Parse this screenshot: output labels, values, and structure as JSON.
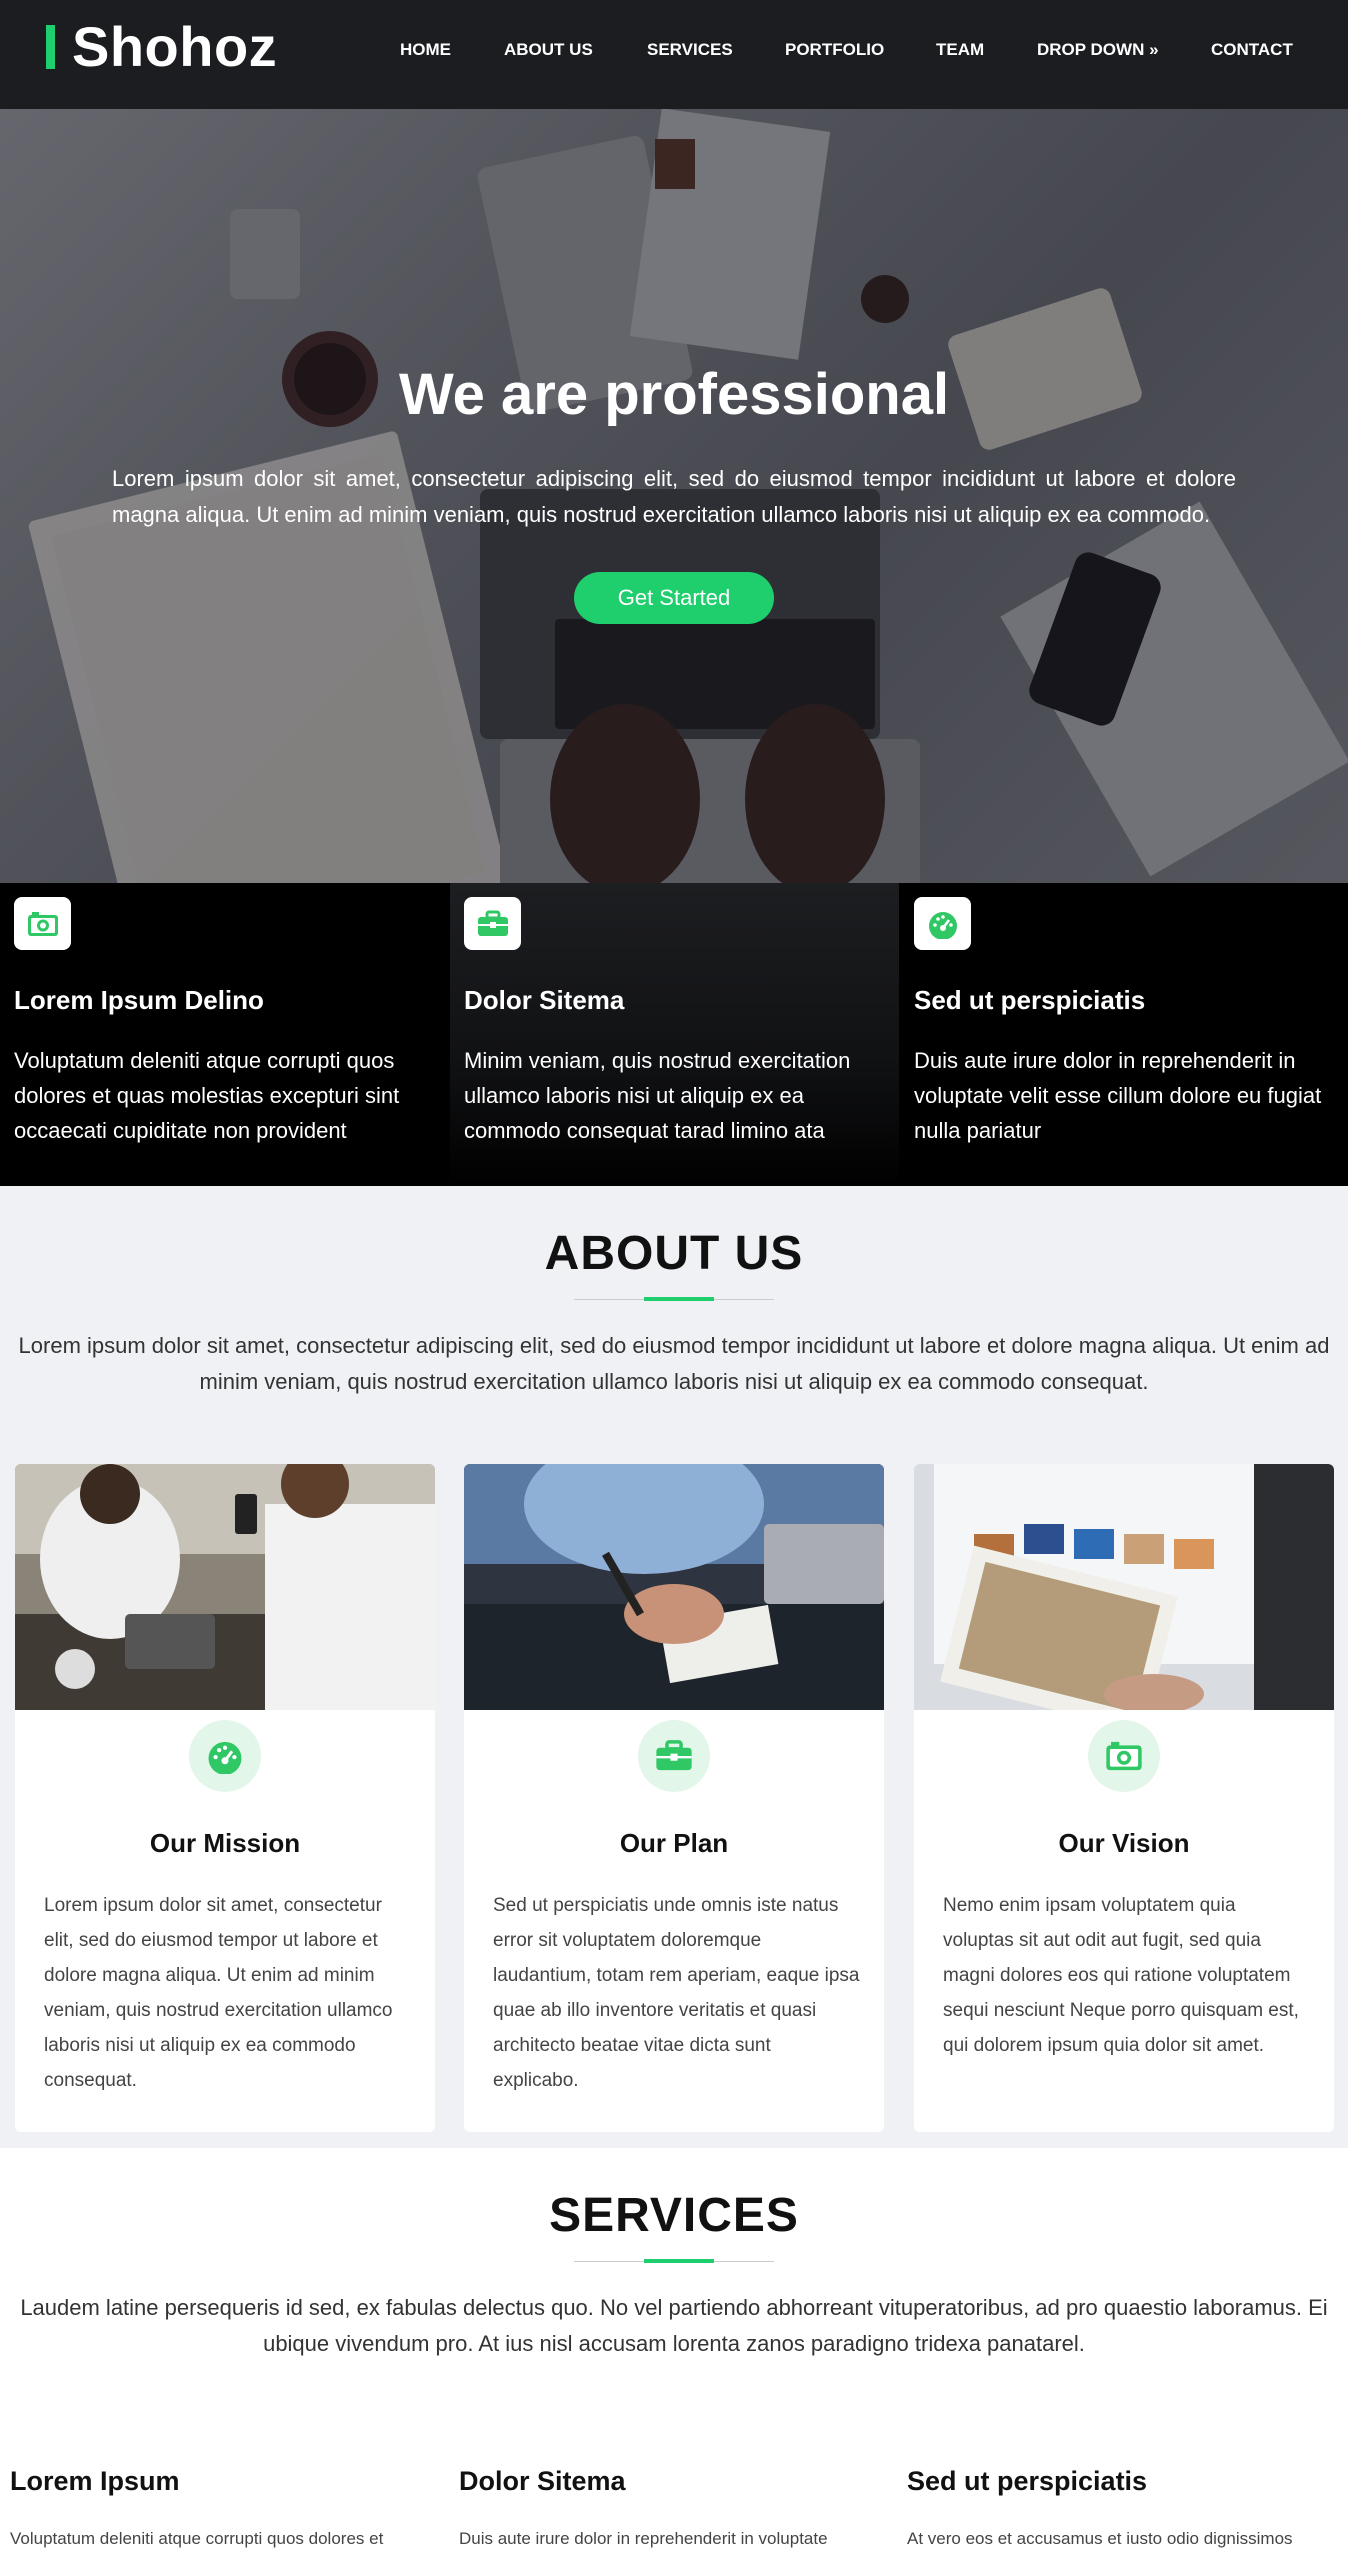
{
  "header": {
    "logo": "Shohoz",
    "nav": [
      "HOME",
      "ABOUT US",
      "SERVICES",
      "PORTFOLIO",
      "TEAM",
      "DROP DOWN »",
      "CONTACT"
    ]
  },
  "hero": {
    "title": "We are professional",
    "text": "Lorem ipsum dolor sit amet, consectetur adipiscing elit, sed do eiusmod tempor incididunt ut labore et dolore magna aliqua. Ut enim ad minim veniam, quis nostrud exercitation ullamco laboris nisi ut aliquip ex ea commodo.",
    "button": "Get Started"
  },
  "features": [
    {
      "icon": "camera-icon",
      "title": "Lorem Ipsum Delino",
      "text": "Voluptatum deleniti atque corrupti quos dolores et quas molestias excepturi sint occaecati cupiditate non provident"
    },
    {
      "icon": "briefcase-icon",
      "title": "Dolor Sitema",
      "text": "Minim veniam, quis nostrud exercitation ullamco laboris nisi ut aliquip ex ea commodo consequat tarad limino ata"
    },
    {
      "icon": "speedometer-icon",
      "title": "Sed ut perspiciatis",
      "text": "Duis aute irure dolor in reprehenderit in voluptate velit esse cillum dolore eu fugiat nulla pariatur"
    }
  ],
  "about": {
    "title": "ABOUT US",
    "lead": "Lorem ipsum dolor sit amet, consectetur adipiscing elit, sed do eiusmod tempor incididunt ut labore et dolore magna aliqua. Ut enim ad minim veniam, quis nostrud exercitation ullamco laboris nisi ut aliquip ex ea commodo consequat.",
    "cards": [
      {
        "icon": "speedometer-icon",
        "title": "Our Mission",
        "text": "Lorem ipsum dolor sit amet, consectetur elit, sed do eiusmod tempor ut labore et dolore magna aliqua. Ut enim ad minim veniam, quis nostrud exercitation ullamco laboris nisi ut aliquip ex ea commodo consequat."
      },
      {
        "icon": "briefcase-icon",
        "title": "Our Plan",
        "text": "Sed ut perspiciatis unde omnis iste natus error sit voluptatem doloremque laudantium, totam rem aperiam, eaque ipsa quae ab illo inventore veritatis et quasi architecto beatae vitae dicta sunt explicabo."
      },
      {
        "icon": "camera-icon",
        "title": "Our Vision",
        "text": "Nemo enim ipsam voluptatem quia voluptas sit aut odit aut fugit, sed quia magni dolores eos qui ratione voluptatem sequi nesciunt Neque porro quisquam est, qui dolorem ipsum quia dolor sit amet."
      }
    ]
  },
  "services": {
    "title": "SERVICES",
    "lead": "Laudem latine persequeris id sed, ex fabulas delectus quo. No vel partiendo abhorreant vituperatoribus, ad pro quaestio laboramus. Ei ubique vivendum pro. At ius nisl accusam lorenta zanos paradigno tridexa panatarel.",
    "items": [
      {
        "title": "Lorem Ipsum",
        "text": "Voluptatum deleniti atque corrupti quos dolores et"
      },
      {
        "title": "Dolor Sitema",
        "text": "Duis aute irure dolor in reprehenderit in voluptate"
      },
      {
        "title": "Sed ut perspiciatis",
        "text": "At vero eos et accusamus et iusto odio dignissimos"
      }
    ]
  },
  "colors": {
    "accent": "#1fcf6d",
    "header_bg": "#1b1d20",
    "about_bg": "#eff1f5"
  }
}
